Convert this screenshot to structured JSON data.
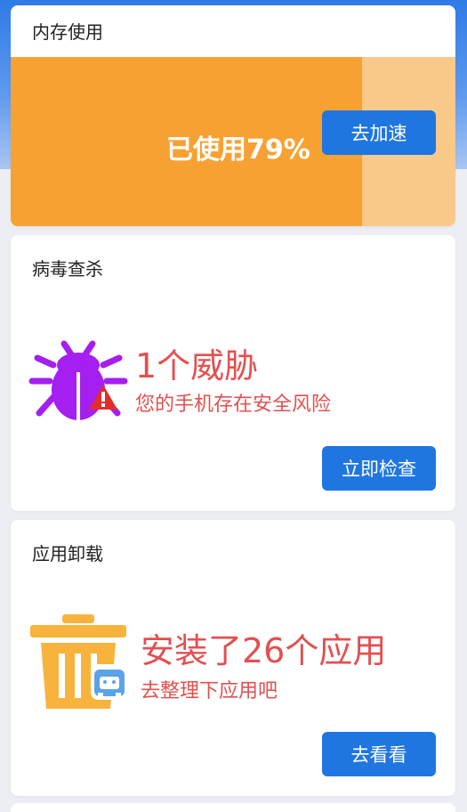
{
  "memory": {
    "title": "内存使用",
    "usage_text": "已使用79%",
    "usage_fraction": 0.79,
    "button_label": "去加速",
    "fill_color": "#f8a133",
    "track_color": "#f9c98a"
  },
  "virus": {
    "title": "病毒查杀",
    "icon": "bug-icon",
    "threat_count_text": "1个威胁",
    "description": "您的手机存在安全风险",
    "button_label": "立即检查",
    "accent_color": "#a51ff0"
  },
  "apps": {
    "title": "应用卸载",
    "icon": "trash-icon",
    "installed_text": "安装了26个应用",
    "description": "去整理下应用吧",
    "button_label": "去看看",
    "accent_color": "#f7b33c"
  },
  "colors": {
    "button": "#1f76e0",
    "warning_text": "#e25050"
  }
}
